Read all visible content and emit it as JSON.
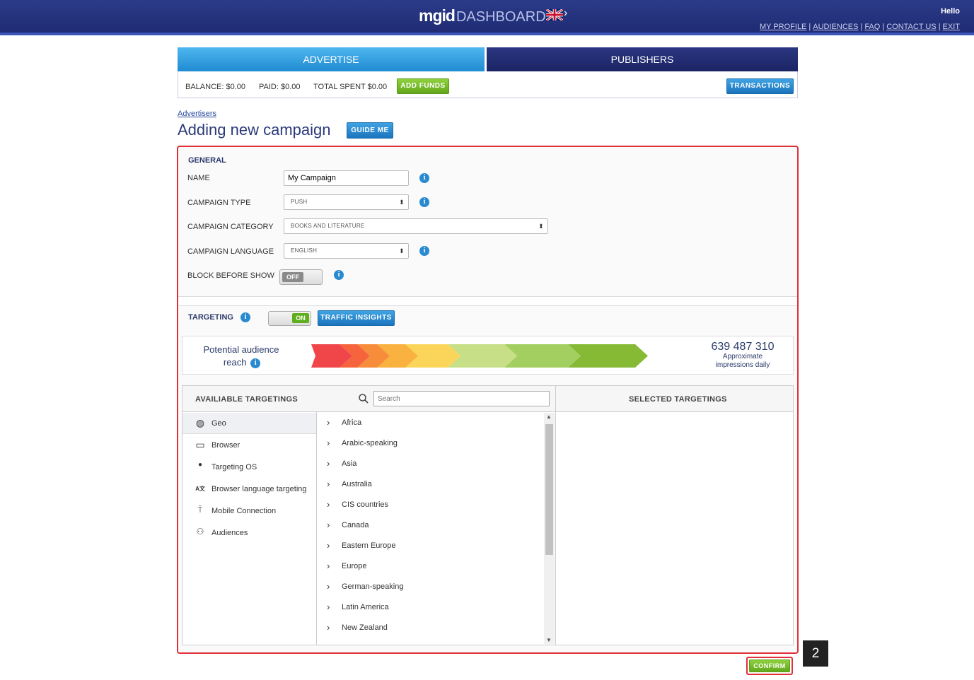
{
  "header": {
    "brand": "mgid",
    "product": "DASHBOARD",
    "greeting": "Hello",
    "links": [
      "MY PROFILE",
      "AUDIENCES",
      "FAQ",
      "CONTACT US",
      "EXIT"
    ],
    "flag_icon": "uk-flag-icon"
  },
  "tabs": [
    {
      "label": "ADVERTISE",
      "active": true
    },
    {
      "label": "PUBLISHERS",
      "active": false
    }
  ],
  "account": {
    "balance_label": "BALANCE:",
    "balance_value": "$0.00",
    "paid_label": "PAID:",
    "paid_value": "$0.00",
    "total_spent_label": "TOTAL SPENT",
    "total_spent_value": "$0.00",
    "add_funds": "ADD FUNDS",
    "transactions": "TRANSACTIONS"
  },
  "breadcrumb": "Advertisers",
  "page_title": "Adding new campaign",
  "guide_me": "GUIDE ME",
  "general": {
    "heading": "GENERAL",
    "name_label": "NAME",
    "name_value": "My Campaign",
    "type_label": "CAMPAIGN TYPE",
    "type_value": "PUSH",
    "category_label": "CAMPAIGN CATEGORY",
    "category_value": "BOOKS AND LITERATURE",
    "language_label": "CAMPAIGN LANGUAGE",
    "language_value": "ENGLISH",
    "block_label": "BLOCK BEFORE SHOW",
    "block_toggle": "OFF"
  },
  "targeting": {
    "heading": "TARGETING",
    "toggle": "ON",
    "traffic_insights": "TRAFFIC INSIGHTS",
    "reach_label_line1": "Potential audience",
    "reach_label_line2": "reach",
    "reach_number": "639 487 310",
    "reach_sub_line1": "Approximate",
    "reach_sub_line2": "impressions daily",
    "reach_colors": [
      "#f0464a",
      "#f5643d",
      "#f78c3a",
      "#f9b13f",
      "#fbd55a",
      "#c7df86",
      "#a3cf60",
      "#86ba34"
    ],
    "available_heading": "AVAILIABLE TARGETINGS",
    "search_placeholder": "Search",
    "selected_heading": "SELECTED TARGETINGS",
    "categories": [
      {
        "label": "Geo",
        "icon": "globe-icon"
      },
      {
        "label": "Browser",
        "icon": "browser-window-icon"
      },
      {
        "label": "Targeting OS",
        "icon": "apple-icon"
      },
      {
        "label": "Browser language targeting",
        "icon": "language-icon"
      },
      {
        "label": "Mobile Connection",
        "icon": "antenna-icon"
      },
      {
        "label": "Audiences",
        "icon": "people-icon"
      }
    ],
    "regions": [
      "Africa",
      "Arabic-speaking",
      "Asia",
      "Australia",
      "CIS countries",
      "Canada",
      "Eastern Europe",
      "Europe",
      "German-speaking",
      "Latin America",
      "New Zealand"
    ]
  },
  "step_badge": "2",
  "confirm": "CONFIRM"
}
